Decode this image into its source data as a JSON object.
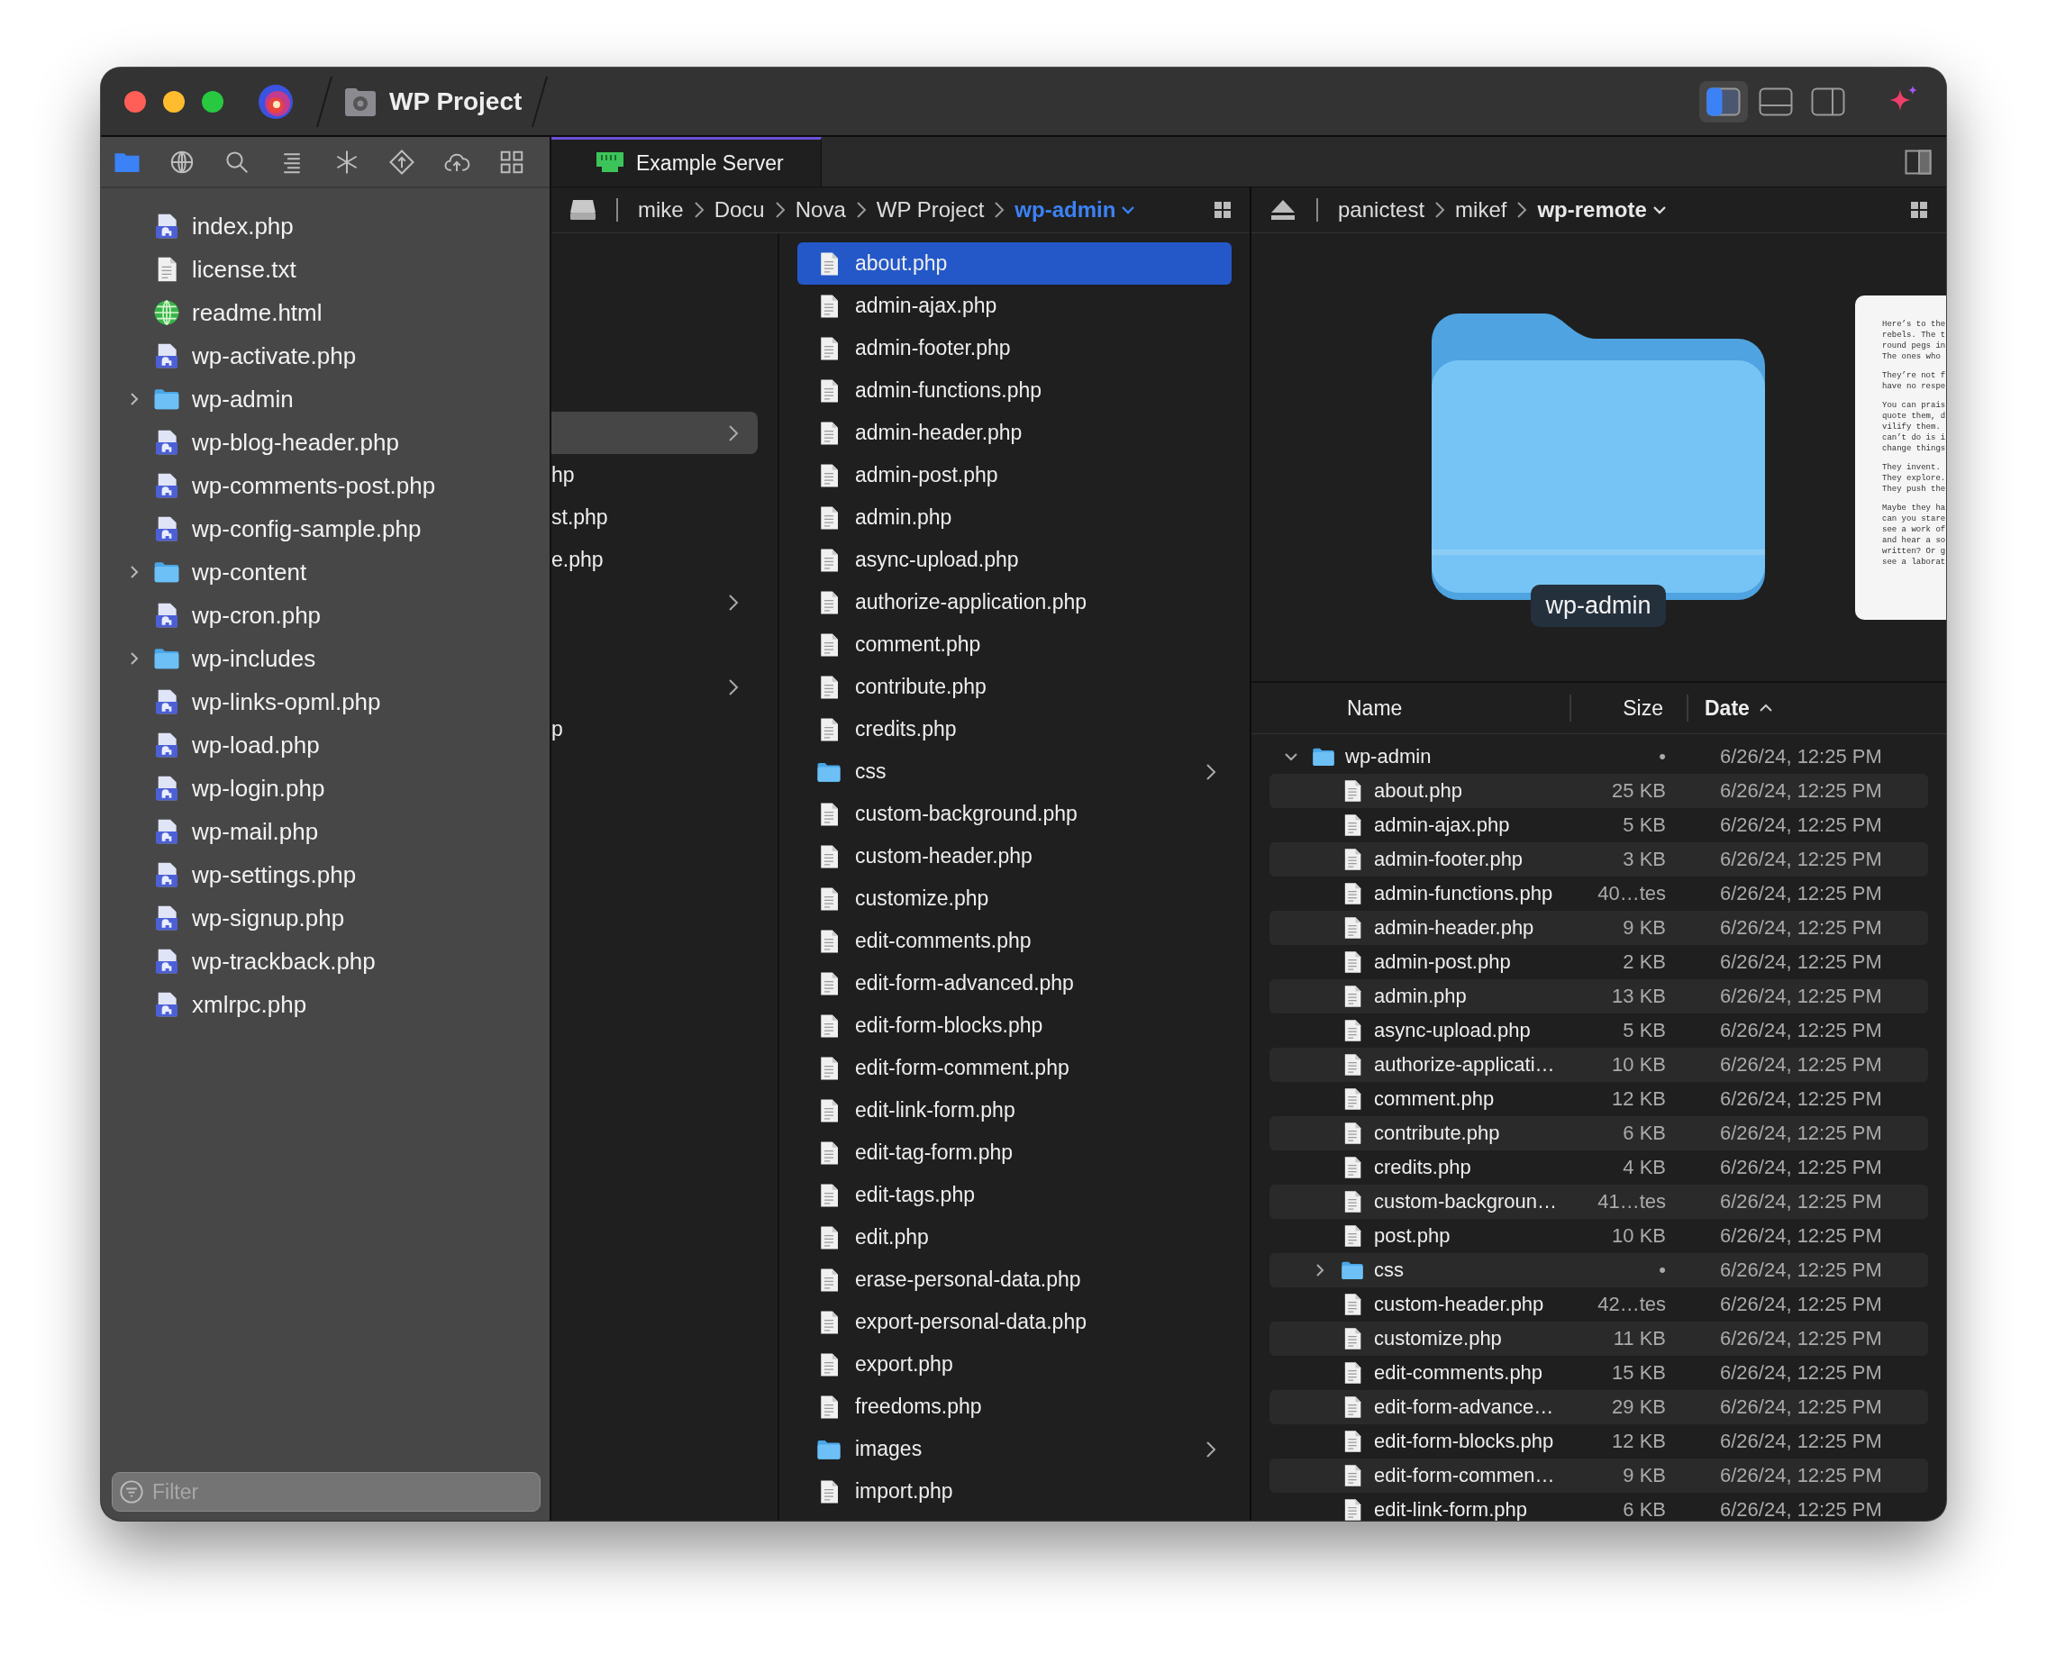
{
  "window": {
    "title": "WP Project"
  },
  "layout_toggles": [
    {
      "kind": "left",
      "selected": true
    },
    {
      "kind": "bottom",
      "selected": false
    },
    {
      "kind": "right",
      "selected": false
    }
  ],
  "sidebar": {
    "tools": [
      {
        "kind": "files",
        "selected": true
      },
      {
        "kind": "web",
        "selected": false
      },
      {
        "kind": "search",
        "selected": false
      },
      {
        "kind": "outline",
        "selected": false
      },
      {
        "kind": "symbols",
        "selected": false
      },
      {
        "kind": "git",
        "selected": false
      },
      {
        "kind": "remote",
        "selected": false
      },
      {
        "kind": "extensions",
        "selected": false
      }
    ],
    "items": [
      {
        "label": "index.php",
        "kind": "php"
      },
      {
        "label": "license.txt",
        "kind": "text"
      },
      {
        "label": "readme.html",
        "kind": "html"
      },
      {
        "label": "wp-activate.php",
        "kind": "php"
      },
      {
        "label": "wp-admin",
        "kind": "folder",
        "expanded": false
      },
      {
        "label": "wp-blog-header.php",
        "kind": "php"
      },
      {
        "label": "wp-comments-post.php",
        "kind": "php"
      },
      {
        "label": "wp-config-sample.php",
        "kind": "php"
      },
      {
        "label": "wp-content",
        "kind": "folder",
        "expanded": false
      },
      {
        "label": "wp-cron.php",
        "kind": "php"
      },
      {
        "label": "wp-includes",
        "kind": "folder",
        "expanded": false
      },
      {
        "label": "wp-links-opml.php",
        "kind": "php"
      },
      {
        "label": "wp-load.php",
        "kind": "php"
      },
      {
        "label": "wp-login.php",
        "kind": "php"
      },
      {
        "label": "wp-mail.php",
        "kind": "php"
      },
      {
        "label": "wp-settings.php",
        "kind": "php"
      },
      {
        "label": "wp-signup.php",
        "kind": "php"
      },
      {
        "label": "wp-trackback.php",
        "kind": "php"
      },
      {
        "label": "xmlrpc.php",
        "kind": "php"
      }
    ],
    "filter": {
      "placeholder": "Filter"
    }
  },
  "tabs": [
    {
      "label": "Example Server",
      "selected": true
    }
  ],
  "local_path": {
    "crumbs": [
      {
        "label": "mike",
        "current": false
      },
      {
        "label": "Docu",
        "current": false
      },
      {
        "label": "Nova",
        "current": false
      },
      {
        "label": "WP Project",
        "current": false
      },
      {
        "label": "wp-admin",
        "current": true
      }
    ]
  },
  "columns": [
    {
      "focused": false,
      "rows": [
        {
          "kind": "file"
        },
        {
          "kind": "file"
        },
        {
          "kind": "file"
        },
        {
          "kind": "file"
        },
        {
          "kind": "folder",
          "selected": true
        },
        {
          "label": "hp",
          "kind": "file",
          "selected": false
        },
        {
          "label": "st.php",
          "kind": "file",
          "selected": false
        },
        {
          "label": "e.php",
          "kind": "file",
          "selected": false
        },
        {
          "kind": "folder",
          "selected": false
        },
        {
          "kind": "file"
        },
        {
          "kind": "folder",
          "selected": false
        },
        {
          "label": "p",
          "kind": "file",
          "selected": false
        }
      ]
    },
    {
      "focused": true,
      "rows": [
        {
          "label": "about.php",
          "kind": "file",
          "selected": true
        },
        {
          "label": "admin-ajax.php",
          "kind": "file",
          "selected": false
        },
        {
          "label": "admin-footer.php",
          "kind": "file",
          "selected": false
        },
        {
          "label": "admin-functions.php",
          "kind": "file",
          "selected": false
        },
        {
          "label": "admin-header.php",
          "kind": "file",
          "selected": false
        },
        {
          "label": "admin-post.php",
          "kind": "file",
          "selected": false
        },
        {
          "label": "admin.php",
          "kind": "file",
          "selected": false
        },
        {
          "label": "async-upload.php",
          "kind": "file",
          "selected": false
        },
        {
          "label": "authorize-application.php",
          "kind": "file",
          "selected": false
        },
        {
          "label": "comment.php",
          "kind": "file",
          "selected": false
        },
        {
          "label": "contribute.php",
          "kind": "file",
          "selected": false
        },
        {
          "label": "credits.php",
          "kind": "file",
          "selected": false
        },
        {
          "label": "css",
          "kind": "folder",
          "selected": false
        },
        {
          "label": "custom-background.php",
          "kind": "file",
          "selected": false
        },
        {
          "label": "custom-header.php",
          "kind": "file",
          "selected": false
        },
        {
          "label": "customize.php",
          "kind": "file",
          "selected": false
        },
        {
          "label": "edit-comments.php",
          "kind": "file",
          "selected": false
        },
        {
          "label": "edit-form-advanced.php",
          "kind": "file",
          "selected": false
        },
        {
          "label": "edit-form-blocks.php",
          "kind": "file",
          "selected": false
        },
        {
          "label": "edit-form-comment.php",
          "kind": "file",
          "selected": false
        },
        {
          "label": "edit-link-form.php",
          "kind": "file",
          "selected": false
        },
        {
          "label": "edit-tag-form.php",
          "kind": "file",
          "selected": false
        },
        {
          "label": "edit-tags.php",
          "kind": "file",
          "selected": false
        },
        {
          "label": "edit.php",
          "kind": "file",
          "selected": false
        },
        {
          "label": "erase-personal-data.php",
          "kind": "file",
          "selected": false
        },
        {
          "label": "export-personal-data.php",
          "kind": "file",
          "selected": false
        },
        {
          "label": "export.php",
          "kind": "file",
          "selected": false
        },
        {
          "label": "freedoms.php",
          "kind": "file",
          "selected": false
        },
        {
          "label": "images",
          "kind": "folder",
          "selected": false
        },
        {
          "label": "import.php",
          "kind": "file",
          "selected": false
        }
      ]
    }
  ],
  "remote_path": {
    "crumbs": [
      {
        "label": "panictest",
        "current": false
      },
      {
        "label": "mikef",
        "current": false
      },
      {
        "label": "wp-remote",
        "current": true
      }
    ]
  },
  "preview": {
    "caption": "wp-admin",
    "document": [
      [
        "Here’s to the",
        "rebels. The t",
        "round pegs in",
        "The ones who"
      ],
      [
        "They’re not f",
        "have no respe"
      ],
      [
        "You can prais",
        "quote them, d",
        "vilify them.",
        "can’t do is i",
        "change things"
      ],
      [
        "They invent.",
        "They explore.",
        "They push the"
      ],
      [
        "Maybe they ha",
        "can you stare",
        "see a work of",
        "and hear a so",
        "written? Or g",
        "see a laborat"
      ]
    ]
  },
  "table": {
    "columns": [
      {
        "label": "Name",
        "sorted": false
      },
      {
        "label": "Size",
        "sorted": false
      },
      {
        "label": "Date",
        "sorted": true
      }
    ],
    "rows": [
      {
        "name": "wp-admin",
        "kind": "folder",
        "expanded": true,
        "size": "•",
        "date": "6/26/24, 12:25 PM",
        "children": [
          {
            "name": "about.php",
            "kind": "file",
            "size": "25 KB",
            "date": "6/26/24, 12:25 PM"
          },
          {
            "name": "admin-ajax.php",
            "kind": "file",
            "size": "5 KB",
            "date": "6/26/24, 12:25 PM"
          },
          {
            "name": "admin-footer.php",
            "kind": "file",
            "size": "3 KB",
            "date": "6/26/24, 12:25 PM"
          },
          {
            "name": "admin-functions.php",
            "kind": "file",
            "size": "40…tes",
            "date": "6/26/24, 12:25 PM"
          },
          {
            "name": "admin-header.php",
            "kind": "file",
            "size": "9 KB",
            "date": "6/26/24, 12:25 PM"
          },
          {
            "name": "admin-post.php",
            "kind": "file",
            "size": "2 KB",
            "date": "6/26/24, 12:25 PM"
          },
          {
            "name": "admin.php",
            "kind": "file",
            "size": "13 KB",
            "date": "6/26/24, 12:25 PM"
          },
          {
            "name": "async-upload.php",
            "kind": "file",
            "size": "5 KB",
            "date": "6/26/24, 12:25 PM"
          },
          {
            "name": "authorize-applicati…",
            "kind": "file",
            "size": "10 KB",
            "date": "6/26/24, 12:25 PM"
          },
          {
            "name": "comment.php",
            "kind": "file",
            "size": "12 KB",
            "date": "6/26/24, 12:25 PM"
          },
          {
            "name": "contribute.php",
            "kind": "file",
            "size": "6 KB",
            "date": "6/26/24, 12:25 PM"
          },
          {
            "name": "credits.php",
            "kind": "file",
            "size": "4 KB",
            "date": "6/26/24, 12:25 PM"
          },
          {
            "name": "custom-backgroun…",
            "kind": "file",
            "size": "41…tes",
            "date": "6/26/24, 12:25 PM"
          },
          {
            "name": "post.php",
            "kind": "file",
            "size": "10 KB",
            "date": "6/26/24, 12:25 PM"
          },
          {
            "name": "css",
            "kind": "folder",
            "expanded": false,
            "size": "•",
            "date": "6/26/24, 12:25 PM"
          },
          {
            "name": "custom-header.php",
            "kind": "file",
            "size": "42…tes",
            "date": "6/26/24, 12:25 PM"
          },
          {
            "name": "customize.php",
            "kind": "file",
            "size": "11 KB",
            "date": "6/26/24, 12:25 PM"
          },
          {
            "name": "edit-comments.php",
            "kind": "file",
            "size": "15 KB",
            "date": "6/26/24, 12:25 PM"
          },
          {
            "name": "edit-form-advance…",
            "kind": "file",
            "size": "29 KB",
            "date": "6/26/24, 12:25 PM"
          },
          {
            "name": "edit-form-blocks.php",
            "kind": "file",
            "size": "12 KB",
            "date": "6/26/24, 12:25 PM"
          },
          {
            "name": "edit-form-commen…",
            "kind": "file",
            "size": "9 KB",
            "date": "6/26/24, 12:25 PM"
          },
          {
            "name": "edit-link-form.php",
            "kind": "file",
            "size": "6 KB",
            "date": "6/26/24, 12:25 PM"
          }
        ]
      }
    ]
  }
}
